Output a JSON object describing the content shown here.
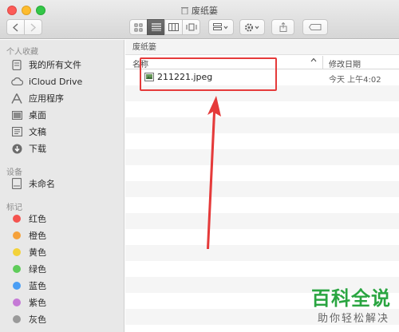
{
  "window": {
    "title": "废纸篓"
  },
  "toolbar": {
    "back_icon": "chevron-left-icon",
    "forward_icon": "chevron-right-icon",
    "view_modes": [
      "icon-view",
      "list-view",
      "column-view",
      "cover-flow-view"
    ],
    "active_view": "list-view"
  },
  "sidebar": {
    "favorites_header": "个人收藏",
    "favorites": [
      {
        "label": "我的所有文件",
        "icon": "all-files-icon"
      },
      {
        "label": "iCloud Drive",
        "icon": "cloud-icon"
      },
      {
        "label": "应用程序",
        "icon": "applications-icon"
      },
      {
        "label": "桌面",
        "icon": "desktop-icon"
      },
      {
        "label": "文稿",
        "icon": "documents-icon"
      },
      {
        "label": "下载",
        "icon": "downloads-icon"
      }
    ],
    "devices_header": "设备",
    "devices": [
      {
        "label": "未命名",
        "icon": "disk-icon"
      }
    ],
    "tags_header": "标记",
    "tags": [
      {
        "label": "红色",
        "color": "#f4534f"
      },
      {
        "label": "橙色",
        "color": "#f5a13b"
      },
      {
        "label": "黄色",
        "color": "#f3d23a"
      },
      {
        "label": "绿色",
        "color": "#5fcc5a"
      },
      {
        "label": "蓝色",
        "color": "#4a9ef4"
      },
      {
        "label": "紫色",
        "color": "#c57ad6"
      },
      {
        "label": "灰色",
        "color": "#9a9a9a"
      }
    ]
  },
  "main": {
    "path": "废纸篓",
    "columns": {
      "name": "名称",
      "date_modified": "修改日期"
    },
    "files": [
      {
        "name": "211221.jpeg",
        "date": "今天 上午4:02",
        "icon": "image-file-icon"
      }
    ]
  },
  "watermark": {
    "title": "百科全说",
    "subtitle": "助你轻松解决"
  }
}
